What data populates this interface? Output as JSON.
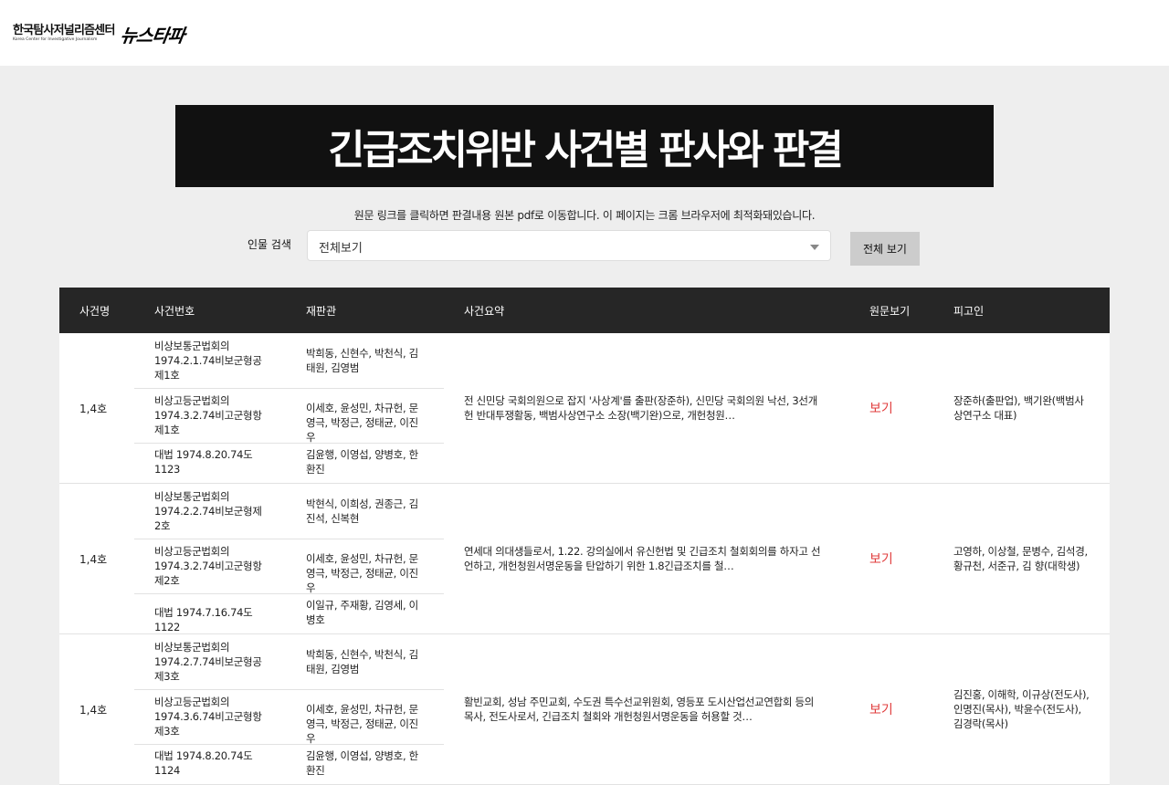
{
  "header": {
    "logo_korean": "한국탐사저널리즘센터",
    "logo_english": "Korea Center for Investigative Journalism",
    "logo_mark": "뉴스타파"
  },
  "banner": {
    "title": "긴급조치위반 사건별 판사와 판결"
  },
  "notice": "원문 링크를 클릭하면 판결내용 원본 pdf로 이동합니다. 이 페이지는 크롬 브라우저에 최적화돼있습니다.",
  "search": {
    "label": "인물 검색",
    "selected": "전체보기",
    "button": "전체 보기"
  },
  "table": {
    "headers": [
      "사건명",
      "사건번호",
      "재판관",
      "사건요약",
      "원문보기",
      "피고인"
    ],
    "rows": [
      {
        "case": "1,4호",
        "subs": [
          {
            "number": "비상보통군법회의 1974.2.1.74비보군형공제1호",
            "judges": "박희동, 신현수, 박천식, 김태원, 김영범"
          },
          {
            "number": "비상고등군법회의 1974.3.2.74비고군형항제1호",
            "judges": "이세호, 윤성민, 차규헌, 문영극, 박정근, 정태균, 이진우"
          },
          {
            "number": "대법 1974.8.20.74도1123",
            "judges": "김윤행, 이영섭, 양병호, 한환진"
          }
        ],
        "summary": "전 신민당 국회의원으로 잡지 '사상계'를 출판(장준하), 신민당 국회의원 낙선, 3선개헌 반대투쟁활동, 백범사상연구소 소장(백기완)으로, 개헌청원…",
        "view": "보기",
        "defendants": "장준하(출판업), 백기완(백범사상연구소 대표)"
      },
      {
        "case": "1,4호",
        "subs": [
          {
            "number": "비상보통군법회의 1974.2.2.74비보군형제2호",
            "judges": "박현식, 이희성, 권종근, 김진석, 신복현"
          },
          {
            "number": "비상고등군법회의 1974.3.2.74비고군형항제2호",
            "judges": "이세호, 윤성민, 차규헌, 문영극, 박정근, 정태균, 이진우"
          },
          {
            "number": "대법 1974.7.16.74도1122",
            "judges": "이일규, 주재황, 김영세, 이병호"
          }
        ],
        "summary": "연세대 의대생들로서, 1.22. 강의실에서 유신헌법 및 긴급조치 철회회의를 하자고 선언하고, 개헌청원서명운동을 탄압하기 위한 1.8긴급조치를 철…",
        "view": "보기",
        "defendants": "고영하, 이상철, 문병수, 김석경, 황규천, 서준규, 김 향(대학생)"
      },
      {
        "case": "1,4호",
        "subs": [
          {
            "number": "비상보통군법회의 1974.2.7.74비보군형공제3호",
            "judges": "박희동, 신현수, 박천식, 김태원, 김영범"
          },
          {
            "number": "비상고등군법회의 1974.3.6.74비고군형항제3호",
            "judges": "이세호, 윤성민, 차규헌, 문영극, 박정근, 정태균, 이진우"
          },
          {
            "number": "대법 1974.8.20.74도1124",
            "judges": "김윤행, 이영섭, 양병호, 한환진"
          }
        ],
        "summary": "활빈교회, 성남 주민교회, 수도권 특수선교위원회, 영등포 도시산업선교연합회 등의 목사, 전도사로서, 긴급조치 철회와 개헌청원서명운동을 허용할 것…",
        "view": "보기",
        "defendants": "김진홍, 이해학, 이규상(전도사), 인명진(목사), 박윤수(전도사), 김경락(목사)"
      }
    ]
  }
}
